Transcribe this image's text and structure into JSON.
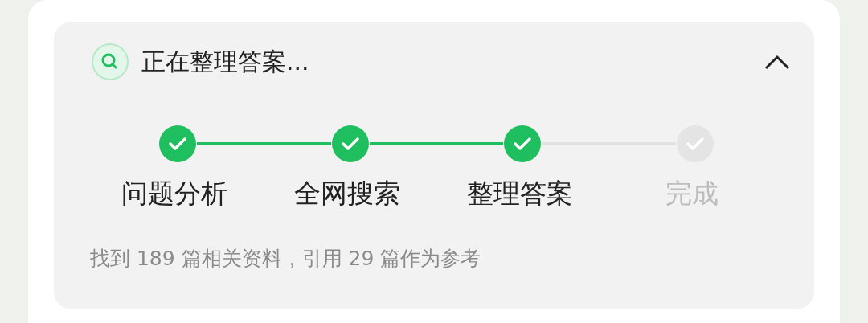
{
  "header": {
    "title": "正在整理答案...",
    "expanded": true
  },
  "steps": [
    {
      "label": "问题分析",
      "done": true
    },
    {
      "label": "全网搜索",
      "done": true
    },
    {
      "label": "整理答案",
      "done": true
    },
    {
      "label": "完成",
      "done": false
    }
  ],
  "summary": "找到 189 篇相关资料，引用 29 篇作为参考"
}
